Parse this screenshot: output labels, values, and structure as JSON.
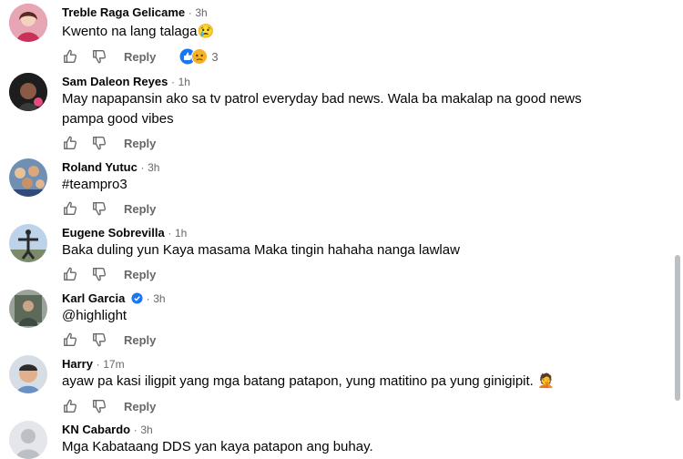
{
  "comments": [
    {
      "name": "Treble Raga Gelicame",
      "time": "3h",
      "text": "Kwento na lang talaga",
      "emoji": "😢",
      "reply": "Reply",
      "reactions": "3"
    },
    {
      "name": "Sam Daleon Reyes",
      "time": "1h",
      "text_line1": "May napapansin ako sa tv patrol everyday bad news. Wala ba makalap na good news",
      "text_line2": "pampa good vibes",
      "reply": "Reply"
    },
    {
      "name": "Roland Yutuc",
      "time": "3h",
      "text": "#teampro3",
      "reply": "Reply"
    },
    {
      "name": "Eugene Sobrevilla",
      "time": "1h",
      "text": "Baka duling yun Kaya masama Maka tingin hahaha nanga lawlaw",
      "reply": "Reply"
    },
    {
      "name": "Karl Garcia",
      "time": "3h",
      "text": "@highlight",
      "reply": "Reply"
    },
    {
      "name": "Harry",
      "time": "17m",
      "text": "ayaw pa kasi iligpit yang mga batang patapon, yung matitino pa yung ginigipit.",
      "emoji": "🤦",
      "reply": "Reply"
    },
    {
      "name": "KN Cabardo",
      "time": "3h",
      "text": "Mga Kabataang DDS yan kaya patapon ang buhay."
    }
  ],
  "separator": "·",
  "icons": [
    "like-icon",
    "dislike-icon",
    "verified-badge-icon",
    "like-reaction-icon",
    "sad-reaction-icon"
  ],
  "colors": {
    "name": "#050505",
    "meta": "#65676b",
    "accent": "#1877f2",
    "sad": "#f7b125"
  }
}
